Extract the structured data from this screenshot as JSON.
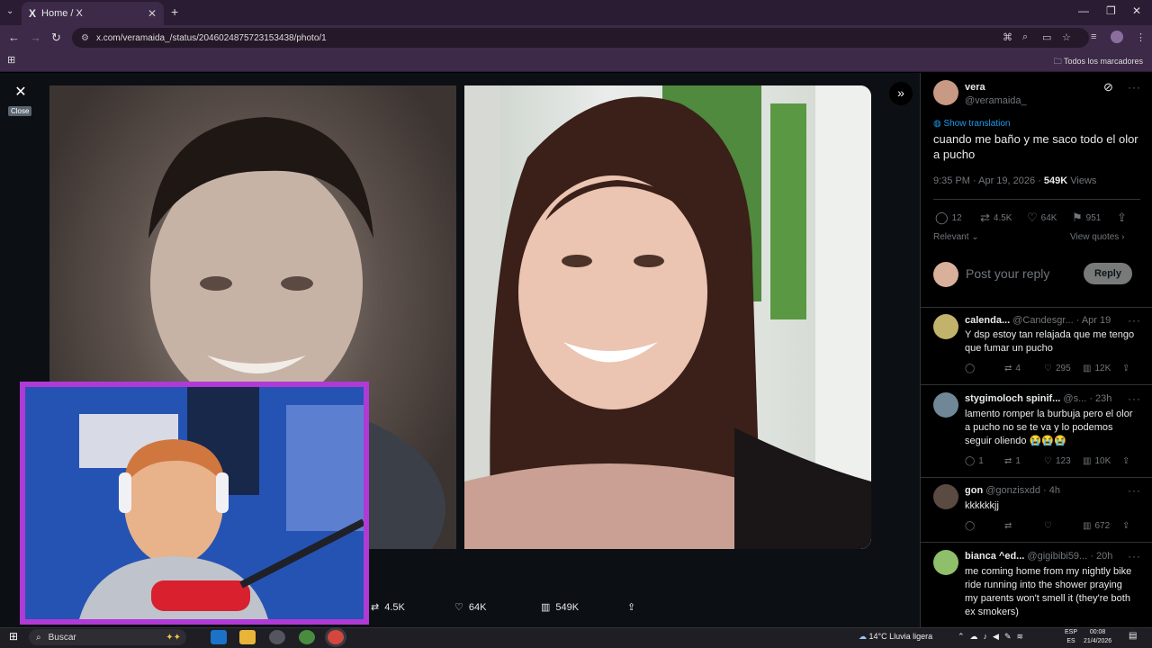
{
  "browser": {
    "tab_title": "Home / X",
    "tab_logo": "X",
    "url": "x.com/veramaida_/status/2046024875723153438/photo/1",
    "bookmarks_label": "Todos los marcadores"
  },
  "viewer": {
    "close_tooltip": "Close",
    "actions": {
      "retweets": "4.5K",
      "likes": "64K",
      "views": "549K"
    }
  },
  "tweet": {
    "name": "vera",
    "handle": "@veramaida_",
    "show_translation": "Show translation",
    "text": "cuando me baño y me saco todo el olor a pucho",
    "time": "9:35 PM · Apr 19, 2026 · ",
    "views_count": "549K",
    "views_label": " Views",
    "replies": "12",
    "retweets": "4.5K",
    "likes": "64K",
    "bookmarks": "951",
    "sort_label": "Relevant",
    "view_quotes": "View quotes",
    "reply_placeholder": "Post your reply",
    "reply_button": "Reply"
  },
  "replies": [
    {
      "name": "calenda...",
      "handle": "@Candesgr...",
      "time": "· Apr 19",
      "text": "Y dsp estoy tan relajada que me tengo que fumar un pucho",
      "replies": "",
      "retweets": "4",
      "likes": "295",
      "views": "12K"
    },
    {
      "name": "stygimoloch spinif...",
      "handle": "@s...",
      "time": "· 23h",
      "text": "lamento romper la burbuja pero el olor a pucho no se te va y lo podemos seguir oliendo 😭😭😭",
      "replies": "1",
      "retweets": "1",
      "likes": "123",
      "views": "10K"
    },
    {
      "name": "gon",
      "handle": "@gonzisxdd",
      "time": "· 4h",
      "text": "kkkkkkjj",
      "replies": "",
      "retweets": "",
      "likes": "",
      "views": "672"
    },
    {
      "name": "bianca ^ed...",
      "handle": "@gigibibi59...",
      "time": "· 20h",
      "text": "me coming home from my nightly bike ride running into the shower praying my parents won't smell it (they're both ex smokers)",
      "replies": "",
      "retweets": "",
      "likes": "",
      "views": ""
    }
  ],
  "taskbar": {
    "search_placeholder": "Buscar",
    "weather": "14°C  Lluvia ligera",
    "lang_top": "ESP",
    "lang_bottom": "ES",
    "clock_time": "00:08",
    "clock_date": "21/4/2026"
  },
  "colors": {
    "accent_blue": "#1d9bf0",
    "webcam_border": "#b03ad6",
    "browser_frame": "#3d2a48"
  }
}
